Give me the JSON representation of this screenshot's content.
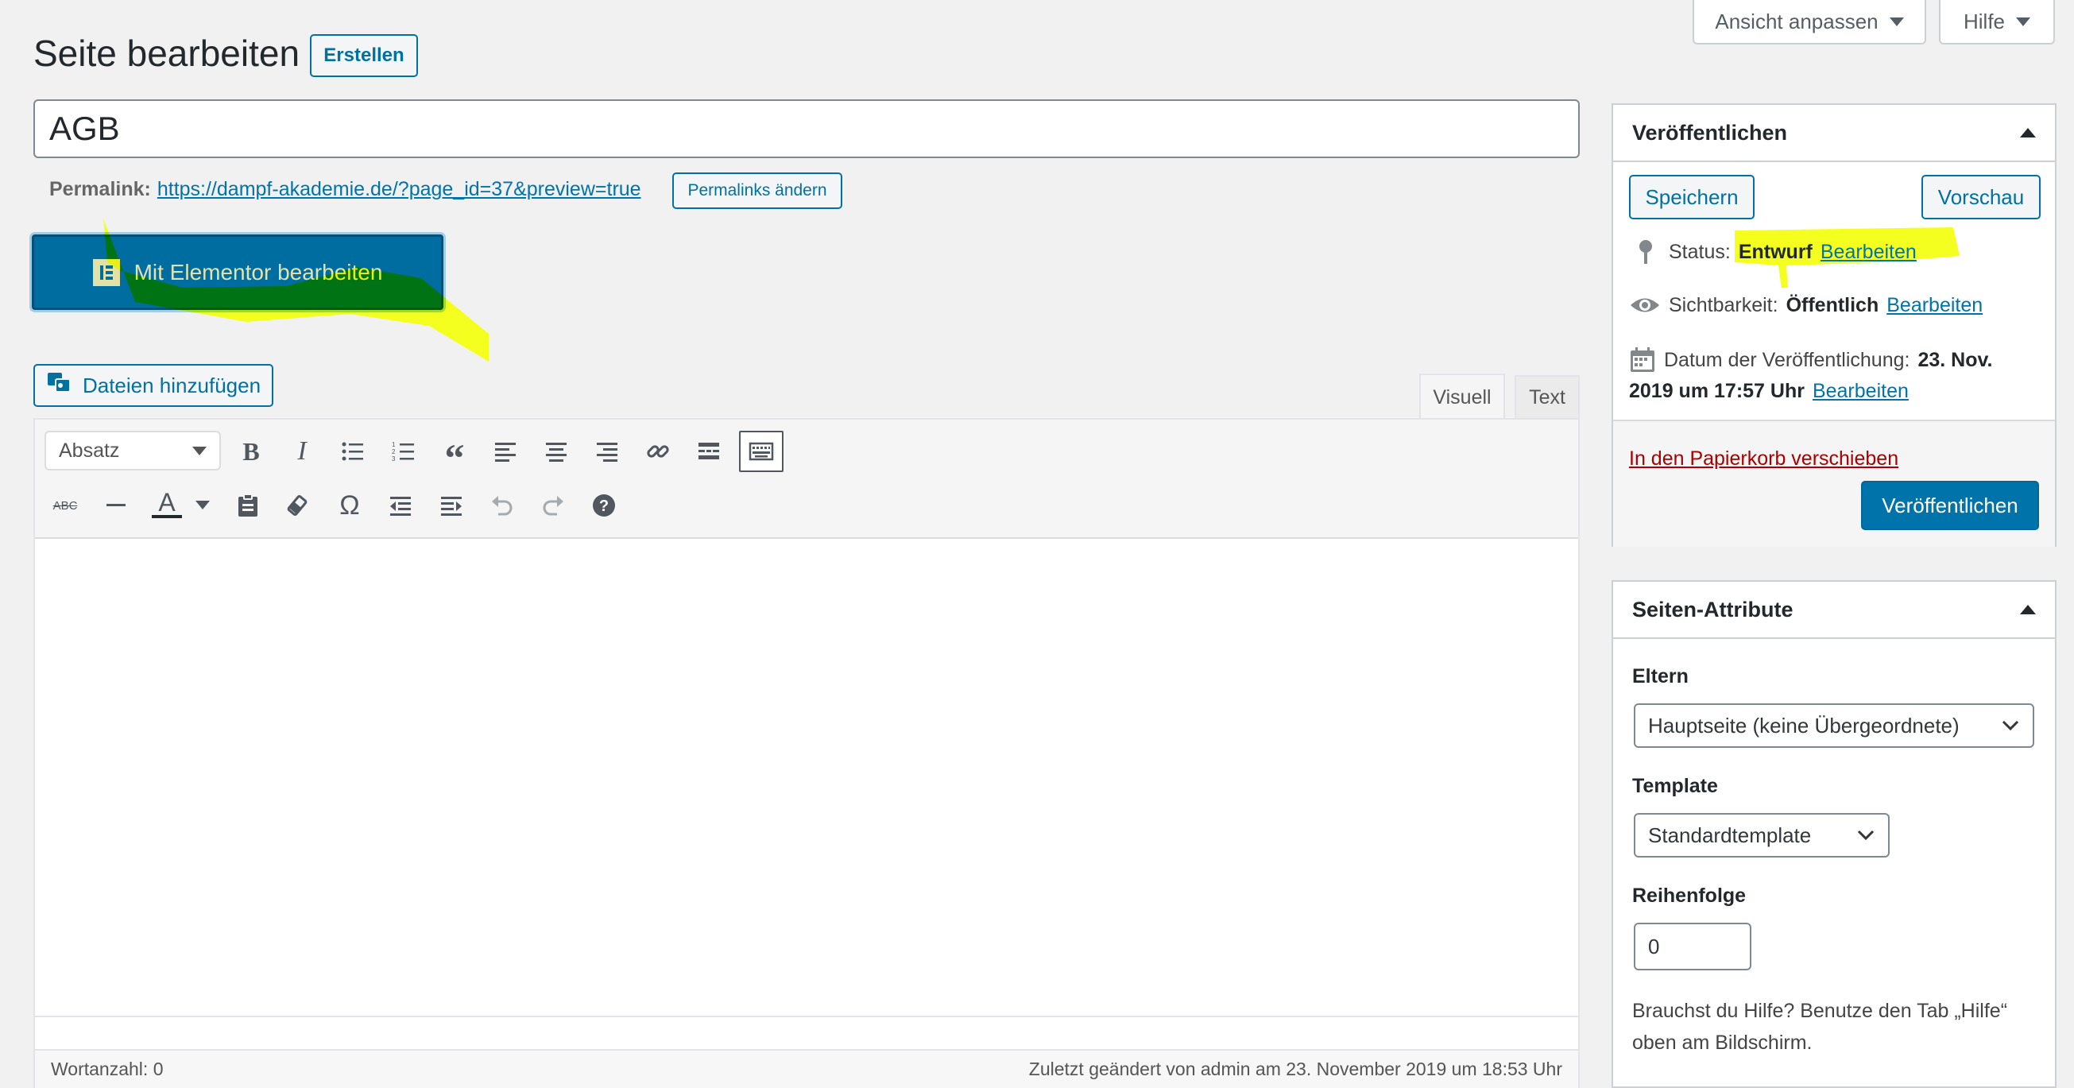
{
  "screen_options": {
    "label": "Ansicht anpassen"
  },
  "help_tab": {
    "label": "Hilfe"
  },
  "header": {
    "title": "Seite bearbeiten",
    "add_new": "Erstellen"
  },
  "post_title": {
    "value": "AGB"
  },
  "permalink": {
    "label": "Permalink:",
    "url": "https://dampf-akademie.de/?page_id=37&preview=true",
    "change_button": "Permalinks ändern"
  },
  "elementor": {
    "button_label": "Mit Elementor bearbeiten"
  },
  "editor": {
    "add_media": "Dateien hinzufügen",
    "tabs": {
      "visual": "Visuell",
      "text": "Text"
    },
    "format_select": "Absatz",
    "word_count": "Wortanzahl: 0",
    "last_modified": "Zuletzt geändert von admin am 23. November 2019 um 18:53 Uhr"
  },
  "publish_box": {
    "title": "Veröffentlichen",
    "save": "Speichern",
    "preview": "Vorschau",
    "status_label": "Status:",
    "status_value": "Entwurf",
    "visibility_label": "Sichtbarkeit:",
    "visibility_value": "Öffentlich",
    "date_label": "Datum der Veröffentlichung:",
    "date_value_line1": "23. Nov.",
    "date_value_line2": "2019 um 17:57 Uhr",
    "edit_link": "Bearbeiten",
    "trash": "In den Papierkorb verschieben",
    "publish": "Veröffentlichen"
  },
  "page_attributes": {
    "title": "Seiten-Attribute",
    "parent_label": "Eltern",
    "parent_value": "Hauptseite (keine Übergeordnete)",
    "template_label": "Template",
    "template_value": "Standardtemplate",
    "order_label": "Reihenfolge",
    "order_value": "0",
    "help_line1": "Brauchst du Hilfe? Benutze den Tab „Hilfe“",
    "help_line2": "oben am Bildschirm."
  },
  "colors": {
    "primary": "#0073aa",
    "primary_dark": "#006799",
    "highlight": "#f5ff1f",
    "trash": "#a00",
    "border": "#ccd0d4"
  }
}
